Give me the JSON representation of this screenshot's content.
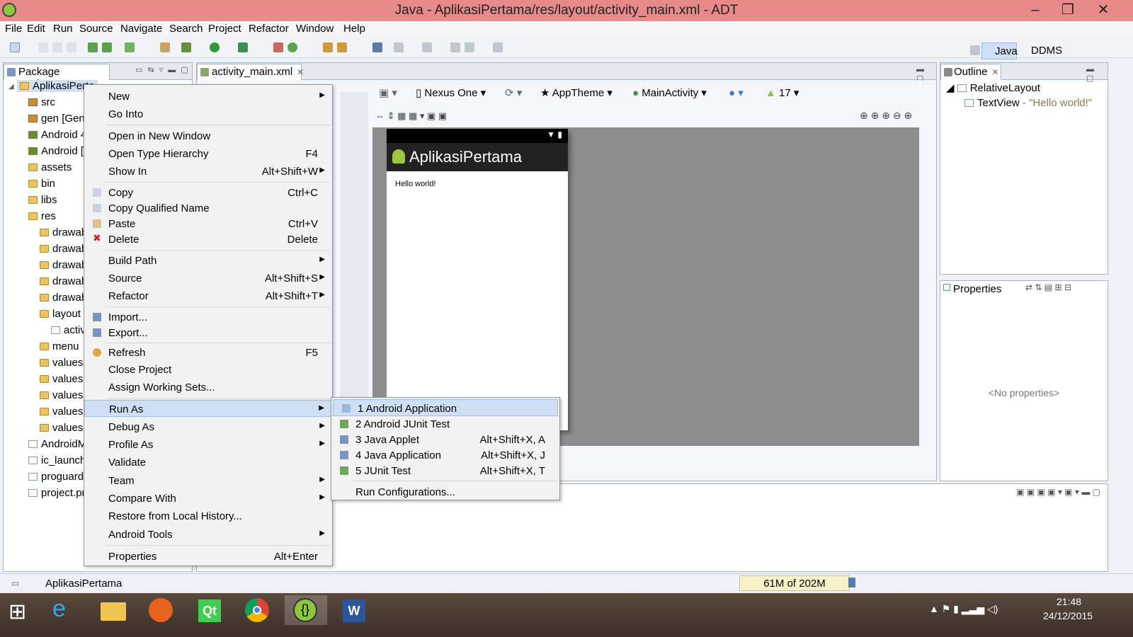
{
  "window": {
    "title": "Java - AplikasiPertama/res/layout/activity_main.xml - ADT"
  },
  "menubar": [
    "File",
    "Edit",
    "Run",
    "Source",
    "Navigate",
    "Search",
    "Project",
    "Refactor",
    "Window",
    "Help"
  ],
  "perspectives": {
    "java": "Java",
    "ddms": "DDMS"
  },
  "package_explorer": {
    "tab_label": "Package Explorer",
    "items": [
      "AplikasiPerta",
      "src",
      "gen [Gene",
      "Android 4",
      "Android [",
      "assets",
      "bin",
      "libs",
      "res",
      "drawab",
      "drawab",
      "drawab",
      "drawab",
      "drawab",
      "layout",
      "activ",
      "menu",
      "values",
      "values-",
      "values-",
      "values-",
      "values-",
      "AndroidM",
      "ic_launche",
      "proguard",
      "project.pr"
    ]
  },
  "editor": {
    "tab_label": "activity_main.xml",
    "device": "Nexus One",
    "theme": "AppTheme",
    "activity": "MainActivity",
    "api": "17",
    "app_title": "AplikasiPertama",
    "hello_text": "Hello world!"
  },
  "outline": {
    "tab_label": "Outline",
    "root": "RelativeLayout",
    "child_type": "TextView",
    "child_value": " - \"Hello world!\""
  },
  "properties": {
    "tab_label": "Properties",
    "empty_text": "<No properties>"
  },
  "context_menu": {
    "items": [
      {
        "label": "New",
        "shortcut": ""
      },
      {
        "label": "Go Into",
        "shortcut": ""
      },
      {
        "label": "Open in New Window",
        "shortcut": ""
      },
      {
        "label": "Open Type Hierarchy",
        "shortcut": "F4"
      },
      {
        "label": "Show In",
        "shortcut": "Alt+Shift+W"
      },
      {
        "label": "Copy",
        "shortcut": "Ctrl+C"
      },
      {
        "label": "Copy Qualified Name",
        "shortcut": ""
      },
      {
        "label": "Paste",
        "shortcut": "Ctrl+V"
      },
      {
        "label": "Delete",
        "shortcut": "Delete"
      },
      {
        "label": "Build Path",
        "shortcut": ""
      },
      {
        "label": "Source",
        "shortcut": "Alt+Shift+S"
      },
      {
        "label": "Refactor",
        "shortcut": "Alt+Shift+T"
      },
      {
        "label": "Import...",
        "shortcut": ""
      },
      {
        "label": "Export...",
        "shortcut": ""
      },
      {
        "label": "Refresh",
        "shortcut": "F5"
      },
      {
        "label": "Close Project",
        "shortcut": ""
      },
      {
        "label": "Assign Working Sets...",
        "shortcut": ""
      },
      {
        "label": "Run As",
        "shortcut": ""
      },
      {
        "label": "Debug As",
        "shortcut": ""
      },
      {
        "label": "Profile As",
        "shortcut": ""
      },
      {
        "label": "Validate",
        "shortcut": ""
      },
      {
        "label": "Team",
        "shortcut": ""
      },
      {
        "label": "Compare With",
        "shortcut": ""
      },
      {
        "label": "Restore from Local History...",
        "shortcut": ""
      },
      {
        "label": "Android Tools",
        "shortcut": ""
      },
      {
        "label": "Properties",
        "shortcut": "Alt+Enter"
      }
    ]
  },
  "run_as_submenu": {
    "items": [
      {
        "label": "1 Android Application",
        "shortcut": ""
      },
      {
        "label": "2 Android JUnit Test",
        "shortcut": ""
      },
      {
        "label": "3 Java Applet",
        "shortcut": "Alt+Shift+X, A"
      },
      {
        "label": "4 Java Application",
        "shortcut": "Alt+Shift+X, J"
      },
      {
        "label": "5 JUnit Test",
        "shortcut": "Alt+Shift+X, T"
      },
      {
        "label": "Run Configurations...",
        "shortcut": ""
      }
    ]
  },
  "statusbar": {
    "selection": "AplikasiPertama",
    "heap": "61M of 202M"
  },
  "taskbar": {
    "time": "21:48",
    "date": "24/12/2015"
  },
  "colors": {
    "titlebar": "#e88a8a",
    "menu_highlight": "#cfe0f6",
    "canvas": "#8d8d8d"
  }
}
